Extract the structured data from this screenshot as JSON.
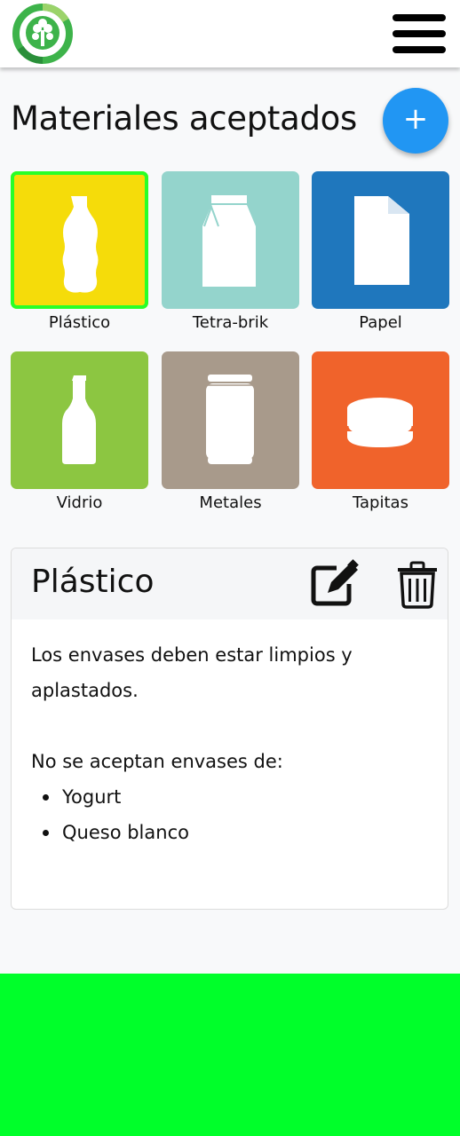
{
  "colors": {
    "fab": "#2196f3",
    "selected_border": "#28ff28",
    "footer": "#00ff2a",
    "logo_green": "#3db34a"
  },
  "header": {
    "logo_icon": "recycling-tree-logo",
    "menu_icon": "hamburger-menu-icon"
  },
  "page": {
    "title": "Materiales aceptados",
    "add_label": "+"
  },
  "materials": [
    {
      "label": "Plástico",
      "icon": "plastic-bottle-icon",
      "color": "#f5dc0a",
      "selected": true
    },
    {
      "label": "Tetra-brik",
      "icon": "carton-icon",
      "color": "#94d4cc",
      "selected": false
    },
    {
      "label": "Papel",
      "icon": "paper-sheet-icon",
      "color": "#1f77bd",
      "selected": false
    },
    {
      "label": "Vidrio",
      "icon": "glass-bottle-icon",
      "color": "#8cc641",
      "selected": false
    },
    {
      "label": "Metales",
      "icon": "metal-can-icon",
      "color": "#a89a8b",
      "selected": false
    },
    {
      "label": "Tapitas",
      "icon": "bottle-cap-icon",
      "color": "#f0632b",
      "selected": false
    }
  ],
  "detail": {
    "title": "Plástico",
    "edit_icon": "edit-icon",
    "delete_icon": "trash-icon",
    "paragraph": "Los envases deben estar limpios y aplastados.",
    "list_intro": "No se aceptan envases de:",
    "items": [
      "Yogurt",
      "Queso blanco"
    ]
  }
}
